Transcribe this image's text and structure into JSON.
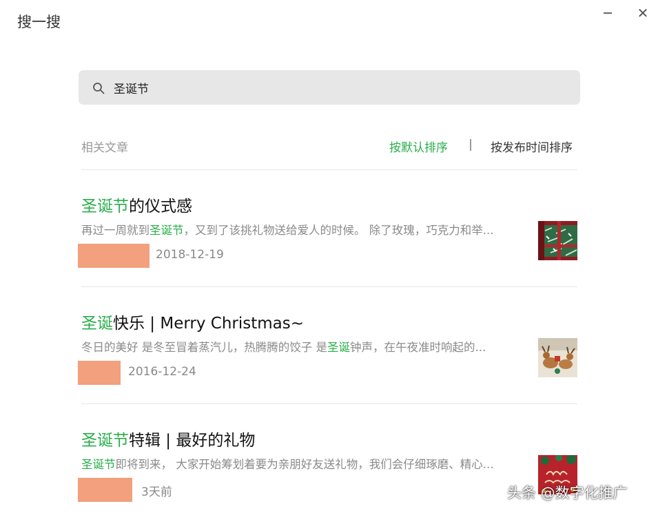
{
  "window": {
    "title": "搜一搜",
    "minimize_glyph": "—",
    "close_glyph": "✕"
  },
  "search": {
    "query": "圣诞节",
    "icon": "search-icon"
  },
  "results_header": {
    "label": "相关文章",
    "sort_default": "按默认排序",
    "sort_time": "按发布时间排序"
  },
  "results": [
    {
      "title_highlight": "圣诞节",
      "title_rest": "的仪式感",
      "snippet_before": "再过一周就到",
      "snippet_highlight": "圣诞节",
      "snippet_after": "，又到了该挑礼物送给爱人的时候。 除了玫瑰，巧克力和举...",
      "date": "2018-12-19",
      "thumbnail": "gift-boxes-image"
    },
    {
      "title_highlight": "圣诞",
      "title_rest": "快乐 | Merry Christmas~",
      "snippet_before": "冬日的美好 是冬至冒着蒸汽儿，热腾腾的饺子 是",
      "snippet_highlight": "圣诞",
      "snippet_after": "钟声，在午夜准时响起的...",
      "date": "2016-12-24",
      "thumbnail": "reindeer-image"
    },
    {
      "title_highlight": "圣诞节",
      "title_rest": "特辑 | 最好的礼物",
      "snippet_before": "",
      "snippet_highlight": "圣诞节",
      "snippet_after": "即将到来， 大家开始筹划着要为亲朋好友送礼物，我们会仔细琢磨、精心...",
      "date": "3天前",
      "thumbnail": "merry-christmas-image"
    }
  ],
  "watermark": "头条 @数字化推广",
  "colors": {
    "accent_green": "#2aae4a",
    "redaction": "#f2a07e",
    "search_bg": "#e7e7e7"
  }
}
